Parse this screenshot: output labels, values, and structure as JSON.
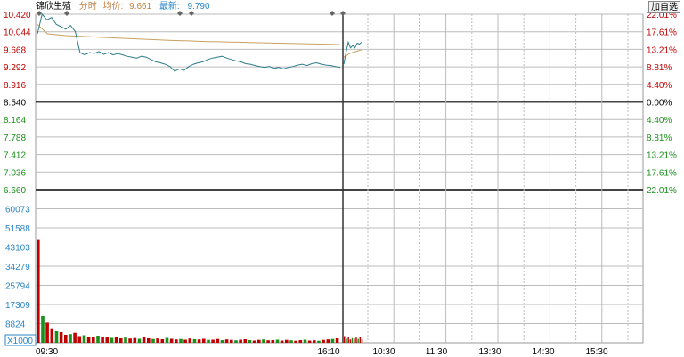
{
  "header": {
    "stock_name": "锦欣生殖",
    "time_label": "分时",
    "avg_label": "均价:",
    "avg_value": "9.661",
    "last_label": "最新:",
    "last_value": "9.790"
  },
  "toolbar": {
    "add_watch_label": "加自选"
  },
  "colors": {
    "up": "#c00000",
    "down": "#1a8f1a",
    "price_line": "#2f7c8a",
    "avg_line": "#c8a060",
    "volume_up": "#c00000",
    "volume_down": "#1a8f1a"
  },
  "chart_data": {
    "type": "line",
    "price_axis": {
      "ticks": [
        "10.420",
        "10.044",
        "9.668",
        "9.292",
        "8.916",
        "8.540",
        "8.164",
        "7.788",
        "7.412",
        "7.036",
        "6.660"
      ],
      "range": [
        6.66,
        10.42
      ],
      "prev_close": 8.54
    },
    "percent_axis": {
      "ticks": [
        "22.01%",
        "17.61%",
        "13.21%",
        "8.81%",
        "4.40%",
        "0.00%",
        "4.40%",
        "8.81%",
        "13.21%",
        "17.61%",
        "22.01%"
      ]
    },
    "volume_axis": {
      "ticks": [
        "60073",
        "51588",
        "43103",
        "34279",
        "25794",
        "17309",
        "8824"
      ],
      "unit": "X1000",
      "range": [
        0,
        68558
      ]
    },
    "time_axis": {
      "ticks": [
        "09:30",
        "16:10",
        "10:30",
        "11:30",
        "13:30",
        "14:30",
        "15:30"
      ]
    },
    "series": [
      {
        "name": "分时",
        "segment1": [
          10.0,
          10.42,
          10.3,
          10.35,
          10.2,
          10.15,
          10.1,
          10.18,
          10.05,
          9.6,
          9.55,
          9.6,
          9.58,
          9.62,
          9.56,
          9.6,
          9.55,
          9.58,
          9.55,
          9.52,
          9.5,
          9.48,
          9.52,
          9.5,
          9.45,
          9.4,
          9.38,
          9.35,
          9.3,
          9.2,
          9.25,
          9.22,
          9.3,
          9.35,
          9.38,
          9.4,
          9.45,
          9.48,
          9.5,
          9.52,
          9.48,
          9.45,
          9.42,
          9.4,
          9.36,
          9.35,
          9.32,
          9.3,
          9.28,
          9.3,
          9.26,
          9.28,
          9.25,
          9.28,
          9.3,
          9.33,
          9.35,
          9.32,
          9.36,
          9.38,
          9.35,
          9.33,
          9.32,
          9.3,
          9.28
        ],
        "segment2": [
          9.35,
          9.6,
          9.82,
          9.7,
          9.75,
          9.7,
          9.8,
          9.78,
          9.82
        ]
      },
      {
        "name": "均价",
        "segment1": [
          10.2,
          10.0,
          9.98,
          9.96,
          9.95,
          9.94,
          9.93,
          9.92,
          9.91,
          9.9,
          9.89,
          9.88,
          9.87,
          9.86,
          9.855,
          9.85,
          9.84,
          9.835,
          9.83,
          9.825,
          9.82,
          9.815,
          9.81,
          9.805,
          9.8,
          9.795,
          9.79,
          9.785,
          9.78,
          9.775,
          9.77
        ],
        "segment2": [
          9.5,
          9.58,
          9.62,
          9.66
        ]
      }
    ],
    "volume": {
      "segment1": [
        46000,
        12000,
        9000,
        6500,
        5200,
        4800,
        3600,
        3900,
        4500,
        3000,
        3400,
        2800,
        2600,
        3200,
        2400,
        2500,
        2200,
        2600,
        2000,
        2300,
        1900,
        2100,
        1800,
        2400,
        2000,
        1700,
        1900,
        1600,
        2200,
        1800,
        1500,
        1700,
        1400,
        1900,
        1600,
        1500,
        1800,
        1300,
        1400,
        1700,
        1200,
        1500,
        1300,
        1100,
        1400,
        1600,
        1200,
        1000,
        1300,
        1500,
        1100,
        1200,
        1400,
        1000,
        1300,
        1100,
        900,
        1200,
        1400,
        1000,
        1100,
        900,
        1300,
        1500,
        1700,
        2000
      ],
      "segment2": [
        3000,
        1800,
        2400,
        1500,
        2100,
        1900,
        2300,
        1700,
        2500,
        1600
      ]
    }
  }
}
